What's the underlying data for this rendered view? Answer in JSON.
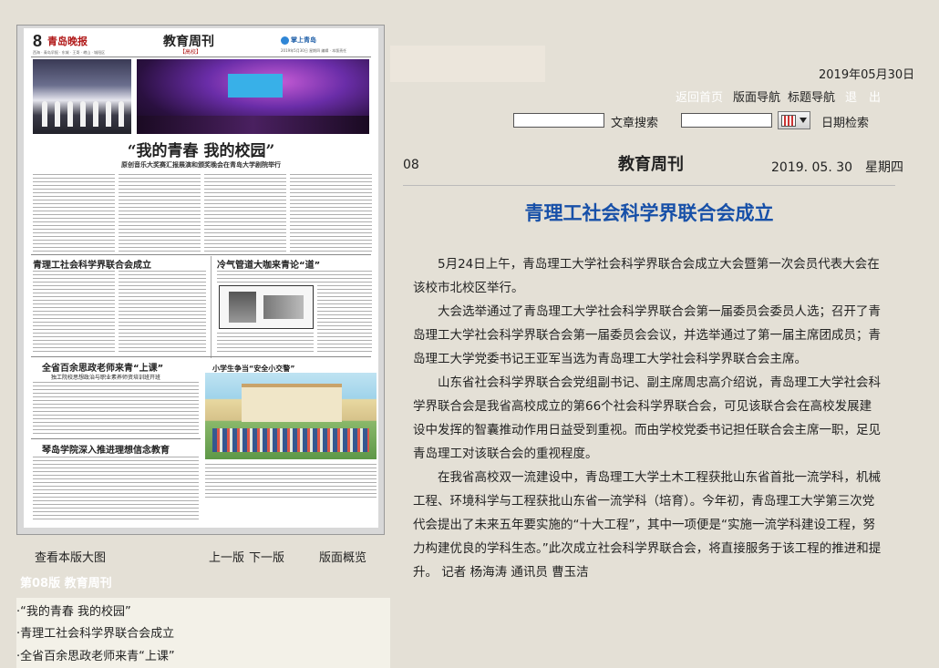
{
  "colors": {
    "background": "#e4e0d6",
    "nav_link": "#ffffff",
    "article_title": "#1750a8",
    "version_label": "#ffffff"
  },
  "thumbnail": {
    "page_number": "8",
    "masthead_logo": "青岛晚报",
    "masthead_small_left": "西海 · 青岛早报 · 东城 · 王哥 · 崂山 · 城阳区",
    "section_title": "教育周刊",
    "section_subtitle": "【高校】",
    "app_name": "掌上青岛",
    "masthead_small_right": "2019年5月30日 星期四 编辑 · 本版责任",
    "headline": "“我的青春 我的校园”",
    "subheadline": "原创音乐大奖赛汇报展演和颁奖晚会在青岛大学剧院举行",
    "block1_title": "青理工社会科学界联合会成立",
    "block2_title": "冷气管道大咖来青论“道”",
    "block3_title": "全省百余思政老师来青“上课”",
    "block3_sub": "独工院校思想政治与职业素养师资培训班开班",
    "block4_title": "小学生争当“安全小交警”",
    "block5_title": "琴岛学院深入推进理想信念教育"
  },
  "left_links": {
    "view_large": "查看本版大图",
    "prev_page": "上一版",
    "next_page": "下一版",
    "overview": "版面概览"
  },
  "version_label": "第08版 教育周刊",
  "article_list": [
    "·“我的青春 我的校园”",
    "·青理工社会科学界联合会成立",
    "·全省百余思政老师来青“上课”"
  ],
  "top": {
    "date": "2019年05月30日",
    "nav": {
      "home": "返回首页",
      "layout_nav": "版面导航",
      "title_nav": "标题导航",
      "exit": "退　出"
    },
    "search_text_label": "文章搜索",
    "search_text_value": "",
    "date_search_value": "",
    "date_search_label": "日期检索"
  },
  "article": {
    "page_no": "08",
    "section": "教育周刊",
    "issue_date": "2019. 05. 30　星期四",
    "title": "青理工社会科学界联合会成立",
    "paragraphs": [
      "5月24日上午，青岛理工大学社会科学界联合会成立大会暨第一次会员代表大会在该校市北校区举行。",
      "大会选举通过了青岛理工大学社会科学界联合会第一届委员会委员人选；召开了青岛理工大学社会科学界联合会第一届委员会会议，并选举通过了第一届主席团成员；青岛理工大学党委书记王亚军当选为青岛理工大学社会科学界联合会主席。",
      "山东省社会科学界联合会党组副书记、副主席周忠高介绍说，青岛理工大学社会科学界联合会是我省高校成立的第66个社会科学界联合会，可见该联合会在高校发展建设中发挥的智囊推动作用日益受到重视。而由学校党委书记担任联合会主席一职，足见青岛理工对该联合会的重视程度。",
      "在我省高校双一流建设中，青岛理工大学土木工程获批山东省首批一流学科，机械工程、环境科学与工程获批山东省一流学科（培育）。今年初，青岛理工大学第三次党代会提出了未来五年要实施的“十大工程”，其中一项便是“实施一流学科建设工程，努力构建优良的学科生态。”此次成立社会科学界联合会，将直接服务于该工程的推进和提升。 记者 杨海涛 通讯员 曹玉洁"
    ]
  }
}
